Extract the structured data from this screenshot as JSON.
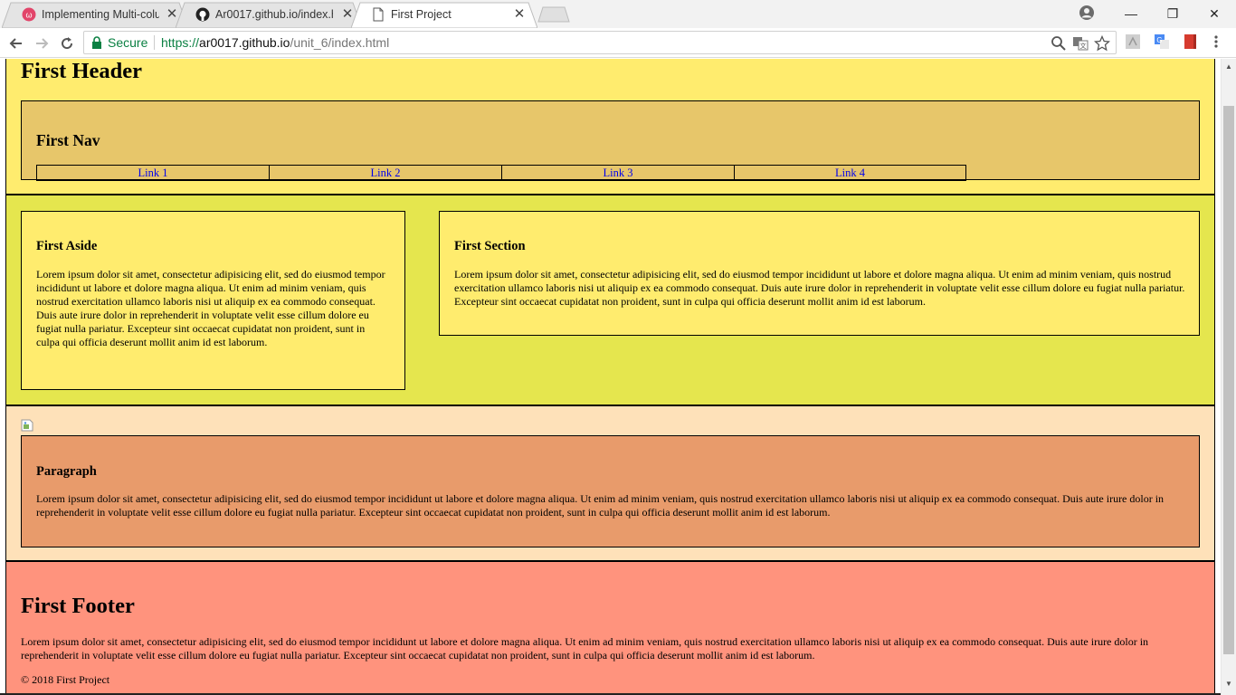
{
  "browser": {
    "tabs": [
      {
        "title": "Implementing Multi-colu",
        "icon": "codecademy-icon",
        "active": false
      },
      {
        "title": "Ar0017.github.io/index.h",
        "icon": "github-icon",
        "active": false
      },
      {
        "title": "First Project",
        "icon": "page-icon",
        "active": true
      }
    ],
    "address": {
      "secure_label": "Secure",
      "url_scheme": "https://",
      "url_host": "ar0017.github.io",
      "url_path": "/unit_6/index.html"
    },
    "colors": {
      "secure": "#0b8043"
    }
  },
  "page": {
    "header": {
      "title": "First Header",
      "nav": {
        "title": "First Nav",
        "links": [
          "Link 1",
          "Link 2",
          "Link 3",
          "Link 4"
        ]
      }
    },
    "aside": {
      "title": "First Aside",
      "text": "Lorem ipsum dolor sit amet, consectetur adipisicing elit, sed do eiusmod tempor incididunt ut labore et dolore magna aliqua. Ut enim ad minim veniam, quis nostrud exercitation ullamco laboris nisi ut aliquip ex ea commodo consequat. Duis aute irure dolor in reprehenderit in voluptate velit esse cillum dolore eu fugiat nulla pariatur. Excepteur sint occaecat cupidatat non proident, sunt in culpa qui officia deserunt mollit anim id est laborum."
    },
    "section": {
      "title": "First Section",
      "text": "Lorem ipsum dolor sit amet, consectetur adipisicing elit, sed do eiusmod tempor incididunt ut labore et dolore magna aliqua. Ut enim ad minim veniam, quis nostrud exercitation ullamco laboris nisi ut aliquip ex ea commodo consequat. Duis aute irure dolor in reprehenderit in voluptate velit esse cillum dolore eu fugiat nulla pariatur. Excepteur sint occaecat cupidatat non proident, sunt in culpa qui officia deserunt mollit anim id est laborum."
    },
    "paragraph": {
      "title": "Paragraph",
      "text": "Lorem ipsum dolor sit amet, consectetur adipisicing elit, sed do eiusmod tempor incididunt ut labore et dolore magna aliqua. Ut enim ad minim veniam, quis nostrud exercitation ullamco laboris nisi ut aliquip ex ea commodo consequat. Duis aute irure dolor in reprehenderit in voluptate velit esse cillum dolore eu fugiat nulla pariatur. Excepteur sint occaecat cupidatat non proident, sunt in culpa qui officia deserunt mollit anim id est laborum."
    },
    "footer": {
      "title": "First Footer",
      "text": "Lorem ipsum dolor sit amet, consectetur adipisicing elit, sed do eiusmod tempor incididunt ut labore et dolore magna aliqua. Ut enim ad minim veniam, quis nostrud exercitation ullamco laboris nisi ut aliquip ex ea commodo consequat. Duis aute irure dolor in reprehenderit in voluptate velit esse cillum dolore eu fugiat nulla pariatur. Excepteur sint occaecat cupidatat non proident, sunt in culpa qui officia deserunt mollit anim id est laborum.",
      "copyright": "© 2018 First Project"
    },
    "colors": {
      "header_bg": "#ffec6e",
      "nav_bg": "#e7c66a",
      "mid_bg": "#e5e64e",
      "paragraph_band_bg": "#fee1b9",
      "paragraph_box_bg": "#e89b6b",
      "footer_bg": "#ff937d",
      "link": "#0000ee"
    }
  }
}
